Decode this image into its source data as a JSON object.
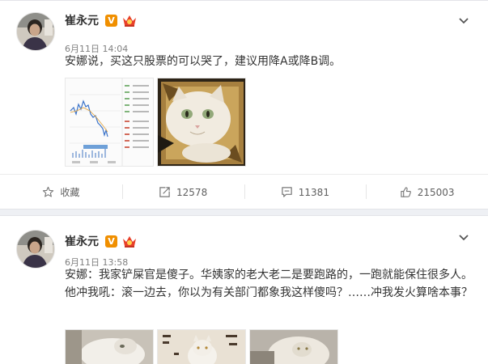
{
  "posts": [
    {
      "author": "崔永元",
      "verified_badge": "V",
      "time": "6月11日 14:04",
      "text": "安娜说，买这只股票的可以哭了，建议用降A或降B调。",
      "actions": {
        "favorite_label": "收藏",
        "repost_count": "12578",
        "comment_count": "11381",
        "like_count": "215003"
      }
    },
    {
      "author": "崔永元",
      "verified_badge": "V",
      "time": "6月11日 13:58",
      "text": "安娜：我家铲屎官是傻子。华姨家的老大老二是要跑路的，一跑就能保住很多人。他冲我吼：滚一边去，你以为有关部门都象我这样傻吗？……冲我发火算啥本事？"
    }
  ],
  "colors": {
    "page_background": "#eef0f4",
    "card_background": "#ffffff",
    "verified_orange": "#f08f00",
    "member_red": "#e8402a",
    "stock_line_blue": "#3b73c9"
  },
  "icons": [
    "chevron-down-icon",
    "star-icon",
    "repost-icon",
    "comment-icon",
    "thumbs-up-icon",
    "member-icon"
  ]
}
